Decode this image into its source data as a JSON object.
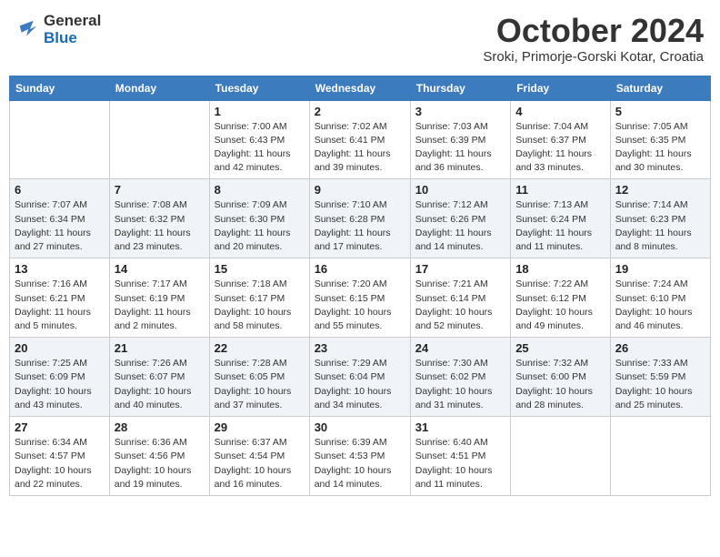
{
  "header": {
    "logo_general": "General",
    "logo_blue": "Blue",
    "title": "October 2024",
    "location": "Sroki, Primorje-Gorski Kotar, Croatia"
  },
  "days_of_week": [
    "Sunday",
    "Monday",
    "Tuesday",
    "Wednesday",
    "Thursday",
    "Friday",
    "Saturday"
  ],
  "weeks": [
    [
      {
        "day": "",
        "info": ""
      },
      {
        "day": "",
        "info": ""
      },
      {
        "day": "1",
        "info": "Sunrise: 7:00 AM\nSunset: 6:43 PM\nDaylight: 11 hours and 42 minutes."
      },
      {
        "day": "2",
        "info": "Sunrise: 7:02 AM\nSunset: 6:41 PM\nDaylight: 11 hours and 39 minutes."
      },
      {
        "day": "3",
        "info": "Sunrise: 7:03 AM\nSunset: 6:39 PM\nDaylight: 11 hours and 36 minutes."
      },
      {
        "day": "4",
        "info": "Sunrise: 7:04 AM\nSunset: 6:37 PM\nDaylight: 11 hours and 33 minutes."
      },
      {
        "day": "5",
        "info": "Sunrise: 7:05 AM\nSunset: 6:35 PM\nDaylight: 11 hours and 30 minutes."
      }
    ],
    [
      {
        "day": "6",
        "info": "Sunrise: 7:07 AM\nSunset: 6:34 PM\nDaylight: 11 hours and 27 minutes."
      },
      {
        "day": "7",
        "info": "Sunrise: 7:08 AM\nSunset: 6:32 PM\nDaylight: 11 hours and 23 minutes."
      },
      {
        "day": "8",
        "info": "Sunrise: 7:09 AM\nSunset: 6:30 PM\nDaylight: 11 hours and 20 minutes."
      },
      {
        "day": "9",
        "info": "Sunrise: 7:10 AM\nSunset: 6:28 PM\nDaylight: 11 hours and 17 minutes."
      },
      {
        "day": "10",
        "info": "Sunrise: 7:12 AM\nSunset: 6:26 PM\nDaylight: 11 hours and 14 minutes."
      },
      {
        "day": "11",
        "info": "Sunrise: 7:13 AM\nSunset: 6:24 PM\nDaylight: 11 hours and 11 minutes."
      },
      {
        "day": "12",
        "info": "Sunrise: 7:14 AM\nSunset: 6:23 PM\nDaylight: 11 hours and 8 minutes."
      }
    ],
    [
      {
        "day": "13",
        "info": "Sunrise: 7:16 AM\nSunset: 6:21 PM\nDaylight: 11 hours and 5 minutes."
      },
      {
        "day": "14",
        "info": "Sunrise: 7:17 AM\nSunset: 6:19 PM\nDaylight: 11 hours and 2 minutes."
      },
      {
        "day": "15",
        "info": "Sunrise: 7:18 AM\nSunset: 6:17 PM\nDaylight: 10 hours and 58 minutes."
      },
      {
        "day": "16",
        "info": "Sunrise: 7:20 AM\nSunset: 6:15 PM\nDaylight: 10 hours and 55 minutes."
      },
      {
        "day": "17",
        "info": "Sunrise: 7:21 AM\nSunset: 6:14 PM\nDaylight: 10 hours and 52 minutes."
      },
      {
        "day": "18",
        "info": "Sunrise: 7:22 AM\nSunset: 6:12 PM\nDaylight: 10 hours and 49 minutes."
      },
      {
        "day": "19",
        "info": "Sunrise: 7:24 AM\nSunset: 6:10 PM\nDaylight: 10 hours and 46 minutes."
      }
    ],
    [
      {
        "day": "20",
        "info": "Sunrise: 7:25 AM\nSunset: 6:09 PM\nDaylight: 10 hours and 43 minutes."
      },
      {
        "day": "21",
        "info": "Sunrise: 7:26 AM\nSunset: 6:07 PM\nDaylight: 10 hours and 40 minutes."
      },
      {
        "day": "22",
        "info": "Sunrise: 7:28 AM\nSunset: 6:05 PM\nDaylight: 10 hours and 37 minutes."
      },
      {
        "day": "23",
        "info": "Sunrise: 7:29 AM\nSunset: 6:04 PM\nDaylight: 10 hours and 34 minutes."
      },
      {
        "day": "24",
        "info": "Sunrise: 7:30 AM\nSunset: 6:02 PM\nDaylight: 10 hours and 31 minutes."
      },
      {
        "day": "25",
        "info": "Sunrise: 7:32 AM\nSunset: 6:00 PM\nDaylight: 10 hours and 28 minutes."
      },
      {
        "day": "26",
        "info": "Sunrise: 7:33 AM\nSunset: 5:59 PM\nDaylight: 10 hours and 25 minutes."
      }
    ],
    [
      {
        "day": "27",
        "info": "Sunrise: 6:34 AM\nSunset: 4:57 PM\nDaylight: 10 hours and 22 minutes."
      },
      {
        "day": "28",
        "info": "Sunrise: 6:36 AM\nSunset: 4:56 PM\nDaylight: 10 hours and 19 minutes."
      },
      {
        "day": "29",
        "info": "Sunrise: 6:37 AM\nSunset: 4:54 PM\nDaylight: 10 hours and 16 minutes."
      },
      {
        "day": "30",
        "info": "Sunrise: 6:39 AM\nSunset: 4:53 PM\nDaylight: 10 hours and 14 minutes."
      },
      {
        "day": "31",
        "info": "Sunrise: 6:40 AM\nSunset: 4:51 PM\nDaylight: 10 hours and 11 minutes."
      },
      {
        "day": "",
        "info": ""
      },
      {
        "day": "",
        "info": ""
      }
    ]
  ]
}
